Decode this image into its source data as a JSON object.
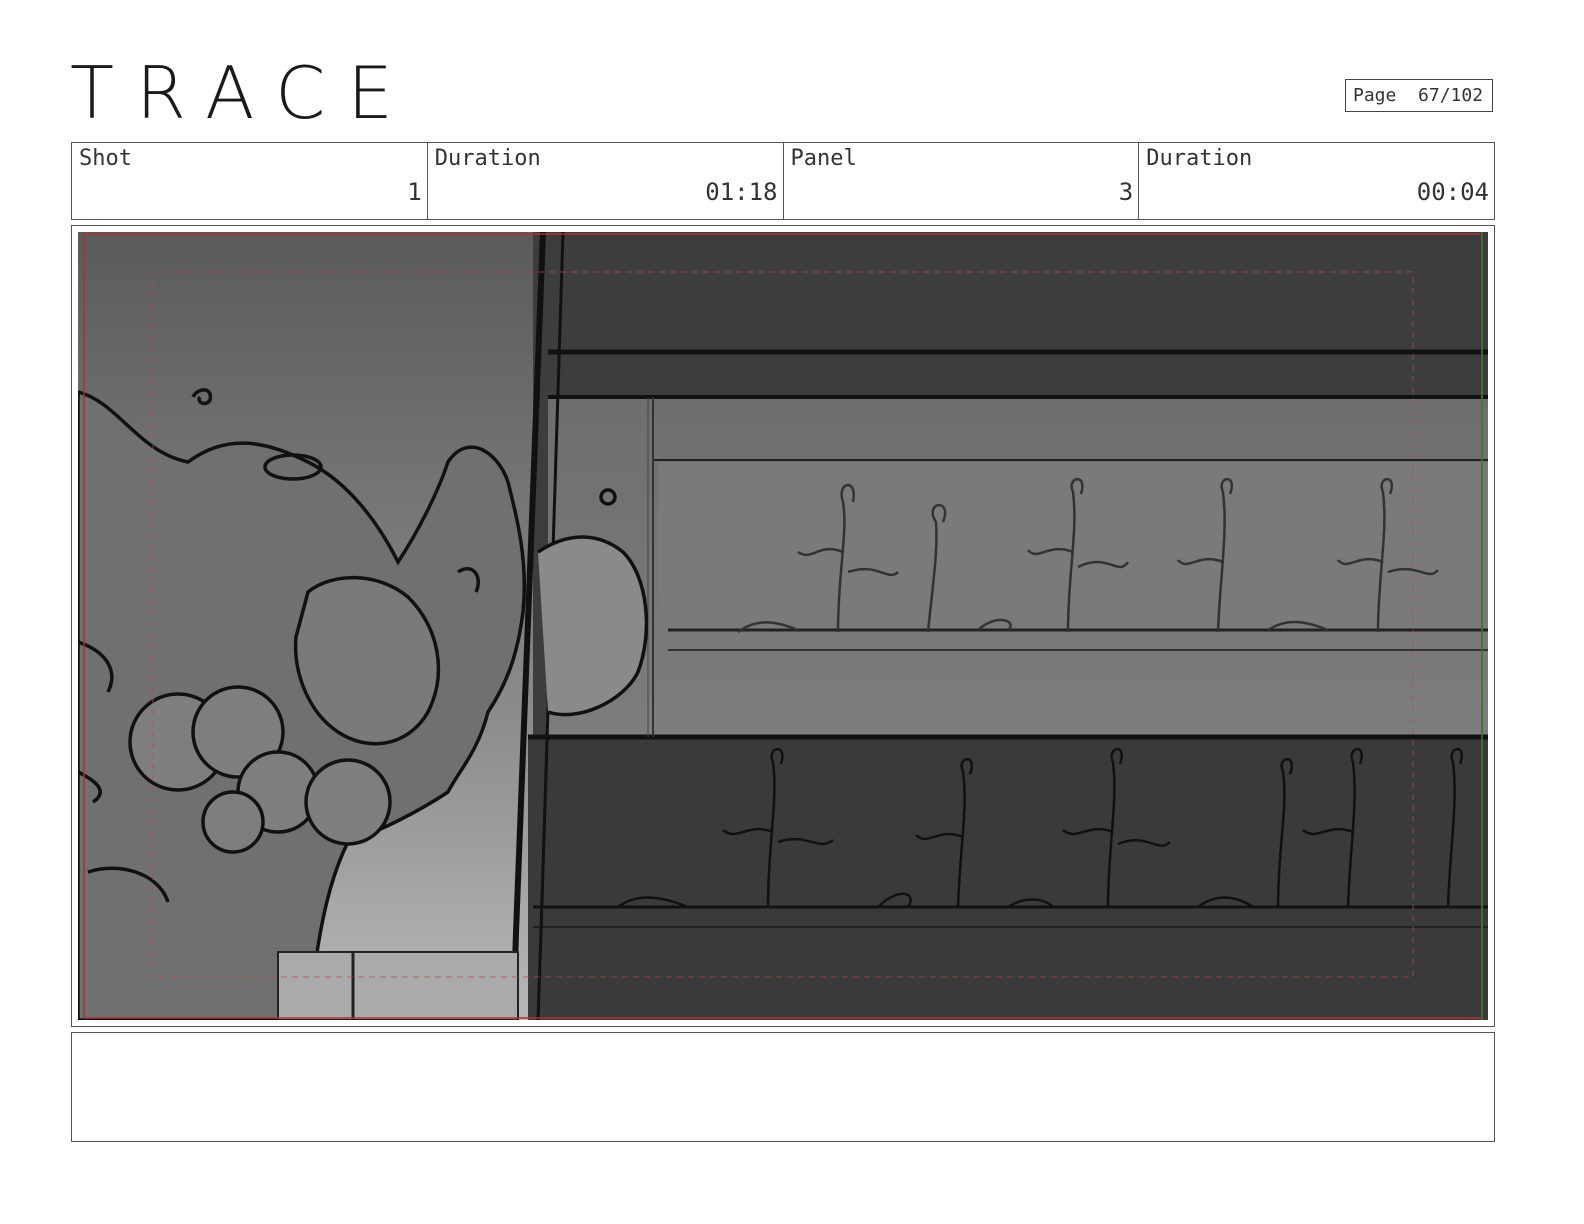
{
  "header": {
    "logo": "TRACE",
    "page_label": "Page",
    "page_value": "67/102"
  },
  "info": {
    "shot_label": "Shot",
    "shot_value": "1",
    "shot_duration_label": "Duration",
    "shot_duration_value": "01:18",
    "panel_label": "Panel",
    "panel_value": "3",
    "panel_duration_label": "Duration",
    "panel_duration_value": "00:04"
  },
  "notes": {
    "text": ""
  }
}
